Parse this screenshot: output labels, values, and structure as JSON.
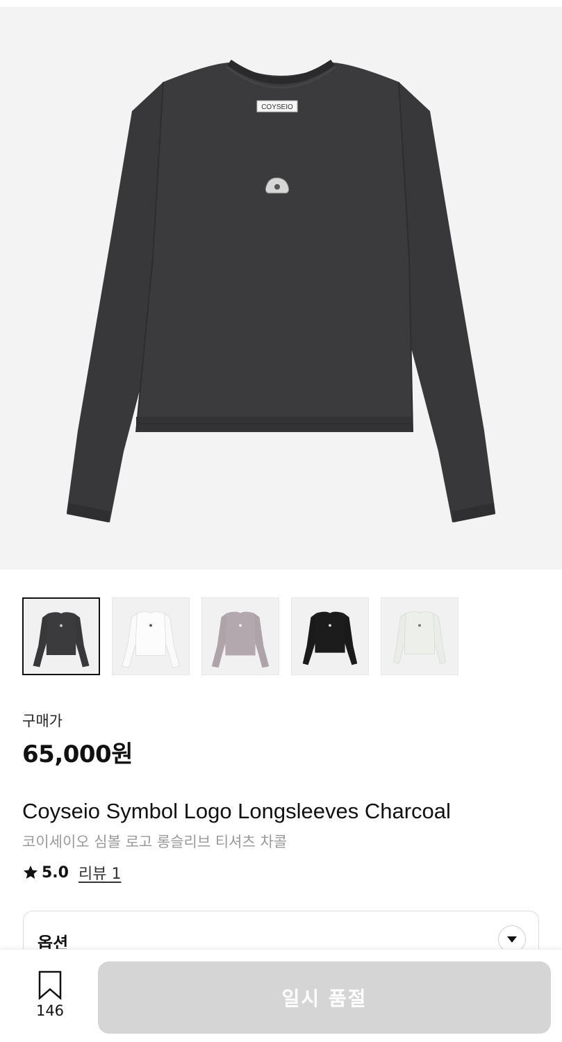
{
  "product": {
    "hero_image": "Coyseio symbol logo longsleeve tee in charcoal",
    "label_text": "COYSEIO",
    "colors": {
      "background": "#f3f3f3",
      "charcoal": "#38383a",
      "white": "#f4f4f4",
      "lavender": "#aea3a8",
      "black": "#1a1a1a",
      "ivory": "#e8ebe6"
    },
    "thumbnails": [
      {
        "color": "#38383a",
        "selected": true
      },
      {
        "color": "#f7f7f7",
        "selected": false
      },
      {
        "color": "#aea3a8",
        "selected": false
      },
      {
        "color": "#1a1a1a",
        "selected": false
      },
      {
        "color": "#e9ece7",
        "selected": false
      }
    ],
    "price_label": "구매가",
    "price": "65,000원",
    "title_en": "Coyseio Symbol Logo Longsleeves Charcoal",
    "title_ko": "코이세이오 심볼 로고 롱슬리브 티셔츠 차콜",
    "rating": "5.0",
    "review_link": "리뷰 1",
    "option_label": "옵션"
  },
  "bottom_bar": {
    "bookmark_count": "146",
    "soldout_label": "일시 품절",
    "icons": {
      "bookmark": "bookmark-icon",
      "star": "star-icon",
      "chevron": "chevron-down-icon"
    }
  }
}
